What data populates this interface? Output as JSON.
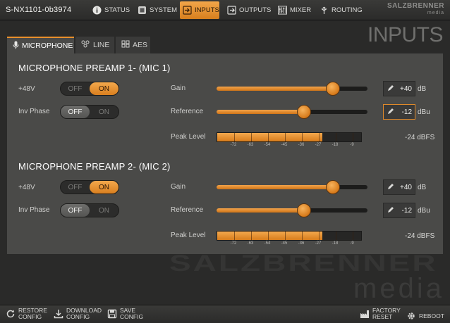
{
  "header": {
    "device_name": "S-NX1101-0b3974",
    "brand": "SALZBRENNER",
    "brand_sub": "media",
    "nav": [
      {
        "label": "STATUS",
        "icon": "info-icon",
        "active": false
      },
      {
        "label": "SYSTEM",
        "icon": "system-icon",
        "active": false
      },
      {
        "label": "INPUTS",
        "icon": "inputs-icon",
        "active": true
      },
      {
        "label": "OUTPUTS",
        "icon": "outputs-icon",
        "active": false
      },
      {
        "label": "MIXER",
        "icon": "mixer-icon",
        "active": false
      },
      {
        "label": "ROUTING",
        "icon": "routing-icon",
        "active": false
      }
    ]
  },
  "page_heading": "INPUTS",
  "watermark": {
    "logo": "SALZBRENNER",
    "media": "media"
  },
  "subtabs": [
    {
      "label": "MICROPHONE",
      "icon": "microphone-icon",
      "active": true
    },
    {
      "label": "LINE",
      "icon": "line-icon",
      "active": false
    },
    {
      "label": "AES",
      "icon": "aes-icon",
      "active": false
    }
  ],
  "labels": {
    "phantom": "+48V",
    "inv_phase": "Inv Phase",
    "gain": "Gain",
    "reference": "Reference",
    "peak_level": "Peak Level",
    "off": "OFF",
    "on": "ON"
  },
  "meter_ticks": [
    "-72",
    "-63",
    "-54",
    "-45",
    "-36",
    "-27",
    "-18",
    "-9"
  ],
  "preamps": [
    {
      "title": "MICROPHONE PREAMP 1- (MIC 1)",
      "phantom_on": true,
      "inv_phase_on": false,
      "gain": {
        "value": "+40",
        "unit": "dB",
        "fraction": 0.77,
        "editing": false
      },
      "reference": {
        "value": "-12",
        "unit": "dBu",
        "fraction": 0.58,
        "editing": true
      },
      "peak": {
        "value": "-24 dBFS",
        "fraction": 0.73
      }
    },
    {
      "title": "MICROPHONE PREAMP 2- (MIC 2)",
      "phantom_on": true,
      "inv_phase_on": false,
      "gain": {
        "value": "+40",
        "unit": "dB",
        "fraction": 0.77,
        "editing": false
      },
      "reference": {
        "value": "-12",
        "unit": "dBu",
        "fraction": 0.58,
        "editing": false
      },
      "peak": {
        "value": "-24 dBFS",
        "fraction": 0.73
      }
    }
  ],
  "footer": {
    "restore": [
      "RESTORE",
      "CONFIG"
    ],
    "download": [
      "DOWNLOAD",
      "CONFIG"
    ],
    "save": [
      "SAVE",
      "CONFIG"
    ],
    "factory": [
      "FACTORY",
      "RESET"
    ],
    "reboot": "REBOOT"
  },
  "colors": {
    "accent": "#e8902c",
    "panel": "#4a4a48",
    "background": "#2a2a29"
  }
}
